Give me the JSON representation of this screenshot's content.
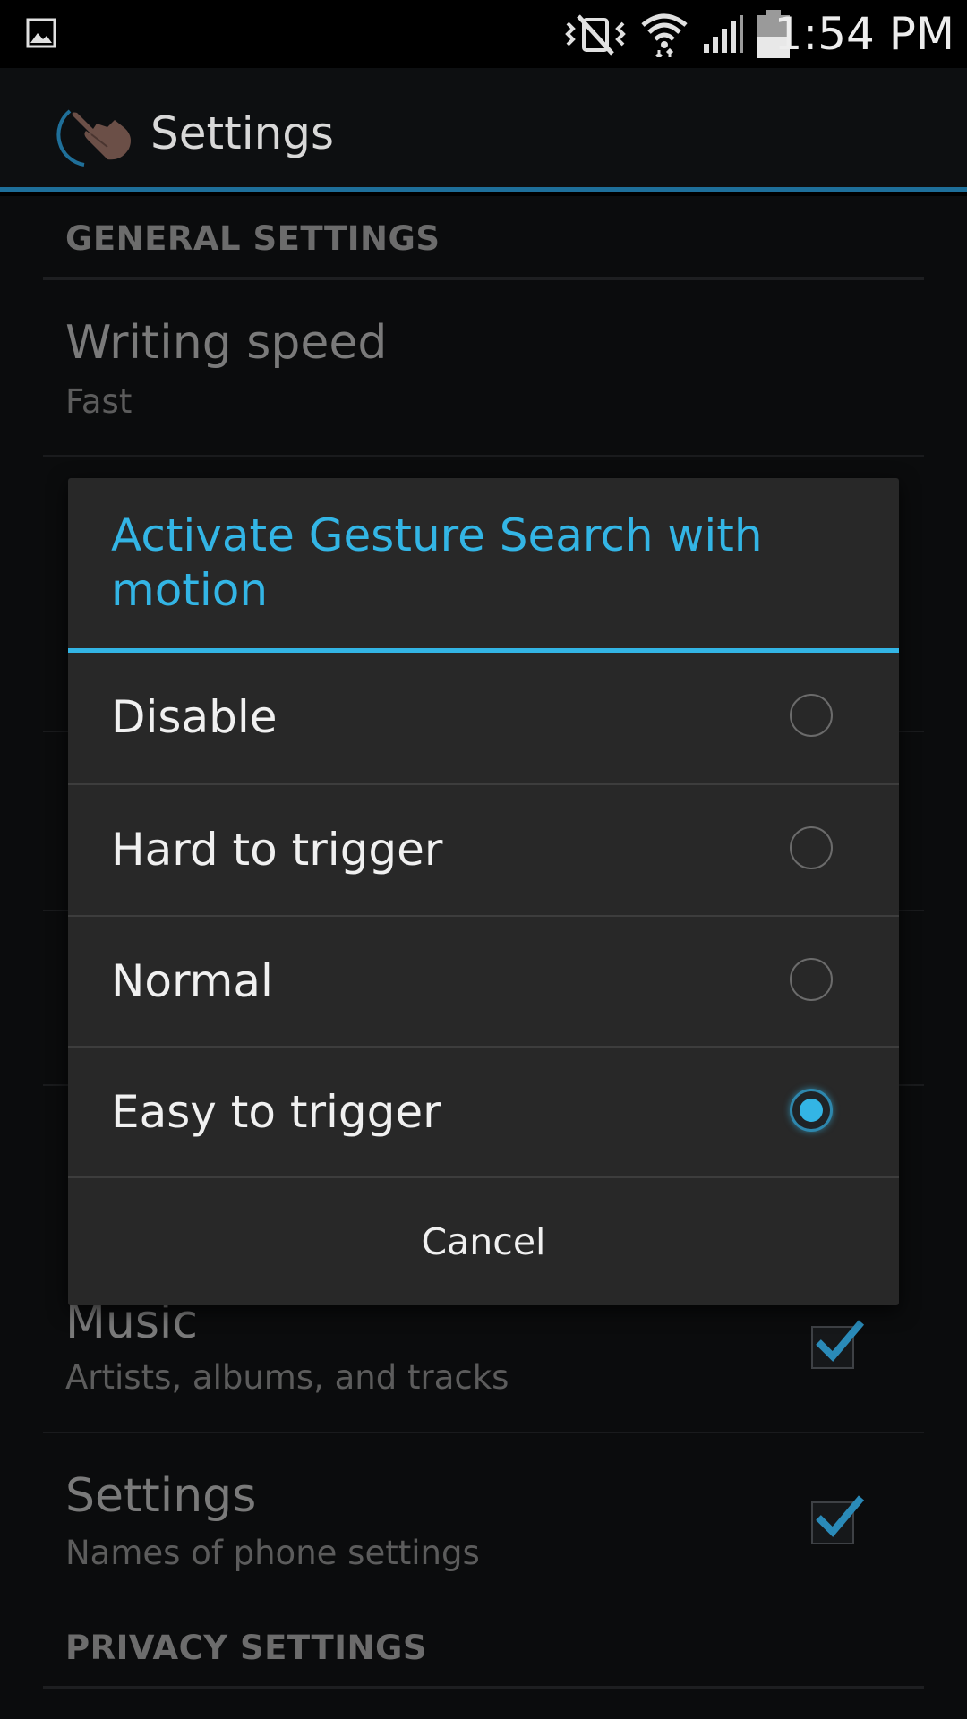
{
  "status_bar": {
    "time": "1:54 PM",
    "icons": [
      "gallery-icon",
      "vibrate-mute-icon",
      "wifi-icon",
      "signal-icon",
      "battery-icon"
    ]
  },
  "action_bar": {
    "title": "Settings",
    "icon": "gesture-hand-icon"
  },
  "settings": {
    "general_header": "GENERAL SETTINGS",
    "writing_speed": {
      "title": "Writing speed",
      "summary": "Fast"
    },
    "music": {
      "title": "Music",
      "summary": "Artists, albums, and tracks",
      "checked": true
    },
    "phone_settings": {
      "title": "Settings",
      "summary": "Names of phone settings",
      "checked": true
    },
    "privacy_header": "PRIVACY SETTINGS"
  },
  "dialog": {
    "title": "Activate Gesture Search with motion",
    "options": [
      {
        "label": "Disable",
        "selected": false
      },
      {
        "label": "Hard to trigger",
        "selected": false
      },
      {
        "label": "Normal",
        "selected": false
      },
      {
        "label": "Easy to trigger",
        "selected": true
      }
    ],
    "cancel_label": "Cancel"
  },
  "colors": {
    "accent": "#33b5e5",
    "action_bar_rule": "#1e6f9a",
    "dialog_background": "#282828"
  }
}
